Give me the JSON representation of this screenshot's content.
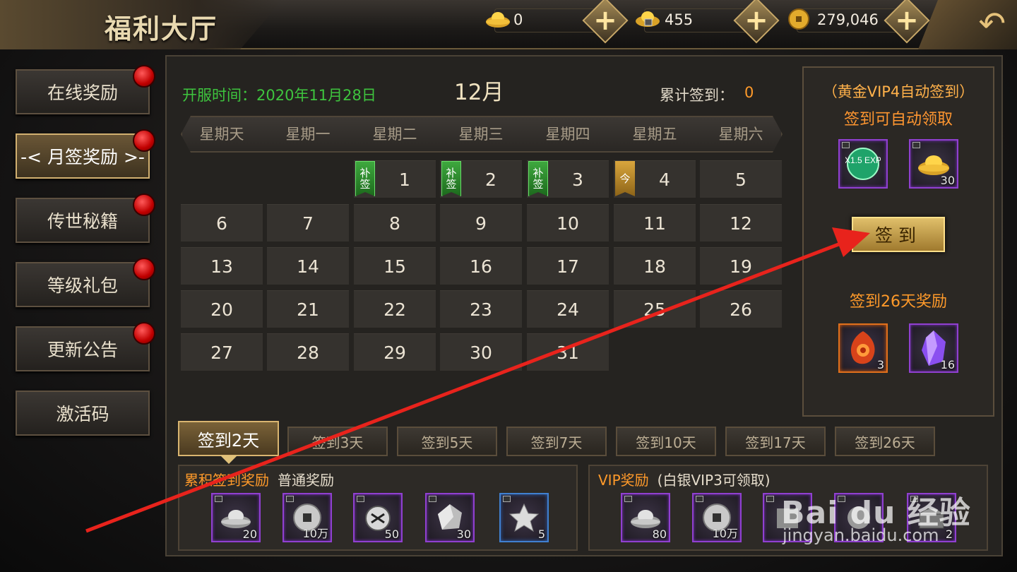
{
  "header": {
    "title": "福利大厅",
    "resources": [
      {
        "icon": "gold-ingot-icon",
        "value": "0"
      },
      {
        "icon": "locked-gold-ingot-icon",
        "value": "455"
      },
      {
        "icon": "gold-coin-icon",
        "value": "279,046"
      }
    ],
    "back_icon": "back-arrow-icon"
  },
  "nav": {
    "items": [
      {
        "label": "在线奖励",
        "dot": true
      },
      {
        "label": "-< 月签奖励 >-",
        "dot": true,
        "active": true
      },
      {
        "label": "传世秘籍",
        "dot": true
      },
      {
        "label": "等级礼包",
        "dot": true
      },
      {
        "label": "更新公告",
        "dot": true
      },
      {
        "label": "激活码",
        "dot": false
      }
    ]
  },
  "calendar": {
    "open_date": "开服时间：2020年11月28日",
    "month": "12月",
    "cumulative_label": "累计签到：",
    "cumulative_value": "0",
    "weekdays": [
      "星期天",
      "星期一",
      "星期二",
      "星期三",
      "星期四",
      "星期五",
      "星期六"
    ],
    "days": [
      {
        "n": "1",
        "badge": "补签",
        "badge_color": "green"
      },
      {
        "n": "2",
        "badge": "补签",
        "badge_color": "green"
      },
      {
        "n": "3",
        "badge": "补签",
        "badge_color": "green"
      },
      {
        "n": "4",
        "badge": "今",
        "badge_color": "gold"
      },
      {
        "n": "5"
      },
      {
        "n": "6"
      },
      {
        "n": "7"
      },
      {
        "n": "8"
      },
      {
        "n": "9"
      },
      {
        "n": "10"
      },
      {
        "n": "11"
      },
      {
        "n": "12"
      },
      {
        "n": "13"
      },
      {
        "n": "14"
      },
      {
        "n": "15"
      },
      {
        "n": "16"
      },
      {
        "n": "17"
      },
      {
        "n": "18"
      },
      {
        "n": "19"
      },
      {
        "n": "20"
      },
      {
        "n": "21"
      },
      {
        "n": "22"
      },
      {
        "n": "23"
      },
      {
        "n": "24"
      },
      {
        "n": "25"
      },
      {
        "n": "26"
      },
      {
        "n": "27"
      },
      {
        "n": "28"
      },
      {
        "n": "29"
      },
      {
        "n": "30"
      },
      {
        "n": "31"
      }
    ]
  },
  "vip": {
    "title": "（黄金VIP4自动签到）",
    "subtitle": "签到可自动领取",
    "items": [
      {
        "icon": "exp-boost-icon",
        "label": "X1.5 EXP",
        "count": ""
      },
      {
        "icon": "gold-ingot-icon",
        "count": "30"
      }
    ],
    "signin_button": "签到",
    "reward_title": "签到26天奖励",
    "reward_items": [
      {
        "icon": "fire-stone-icon",
        "count": "3"
      },
      {
        "icon": "purple-crystal-icon",
        "count": "16"
      }
    ]
  },
  "tabs": [
    "签到2天",
    "签到3天",
    "签到5天",
    "签到7天",
    "签到10天",
    "签到17天",
    "签到26天"
  ],
  "rewards": {
    "cumulative": {
      "title": "累积签到奖励",
      "subtitle": "普通奖励",
      "items": [
        {
          "icon": "silver-ingot-icon",
          "count": "20"
        },
        {
          "icon": "silver-coin-icon",
          "count": "10万"
        },
        {
          "icon": "talisman-icon",
          "count": "50"
        },
        {
          "icon": "silver-gem-icon",
          "count": "30"
        },
        {
          "icon": "star-badge-icon",
          "count": "5"
        }
      ]
    },
    "vip": {
      "title": "VIP奖励",
      "subtitle": "(白银VIP3可领取)",
      "items": [
        {
          "icon": "silver-ingot-icon",
          "count": "80"
        },
        {
          "icon": "silver-coin-icon",
          "count": "10万"
        },
        {
          "icon": "item-icon",
          "count": ""
        },
        {
          "icon": "item-icon",
          "count": ""
        },
        {
          "icon": "chest-icon",
          "count": "2"
        }
      ]
    }
  },
  "watermark": {
    "logo": "Bai du 经验",
    "url": "jingyan.baidu.com"
  },
  "colors": {
    "accent_gold": "#d9b570",
    "green_text": "#3ec43e",
    "orange_text": "#ff9a2a",
    "arrow_red": "#e8231c"
  }
}
